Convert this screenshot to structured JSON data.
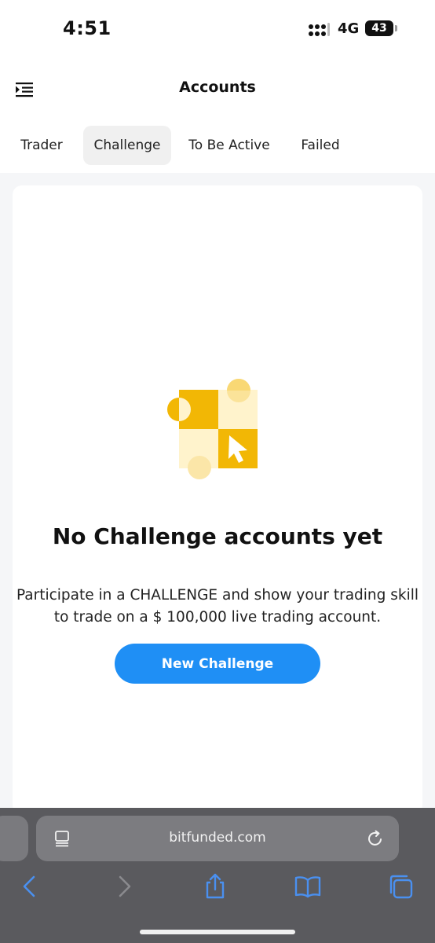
{
  "status_bar": {
    "time": "4:51",
    "network": "4G",
    "battery": "43"
  },
  "header": {
    "title": "Accounts",
    "menu_icon": "menu-collapse-icon"
  },
  "tabs": [
    {
      "label": "Trader",
      "active": false
    },
    {
      "label": "Challenge",
      "active": true
    },
    {
      "label": "To Be Active",
      "active": false
    },
    {
      "label": "Failed",
      "active": false
    }
  ],
  "empty_state": {
    "illustration_icon": "checker-cursor-illustration",
    "title": "No Challenge accounts yet",
    "description": "Participate in a CHALLENGE and show your trading skill to trade on a $ 100,000 live trading account.",
    "button_label": "New Challenge"
  },
  "browser": {
    "url": "bitfunded.com",
    "toolbar_icons": [
      "back-icon",
      "forward-icon",
      "share-icon",
      "bookmarks-icon",
      "tabs-icon"
    ]
  },
  "colors": {
    "accent_blue": "#1f8ff5",
    "illustration_yellow": "#f2b705",
    "illustration_cream": "#fff3cc",
    "browser_bar": "#5a5a5e"
  }
}
